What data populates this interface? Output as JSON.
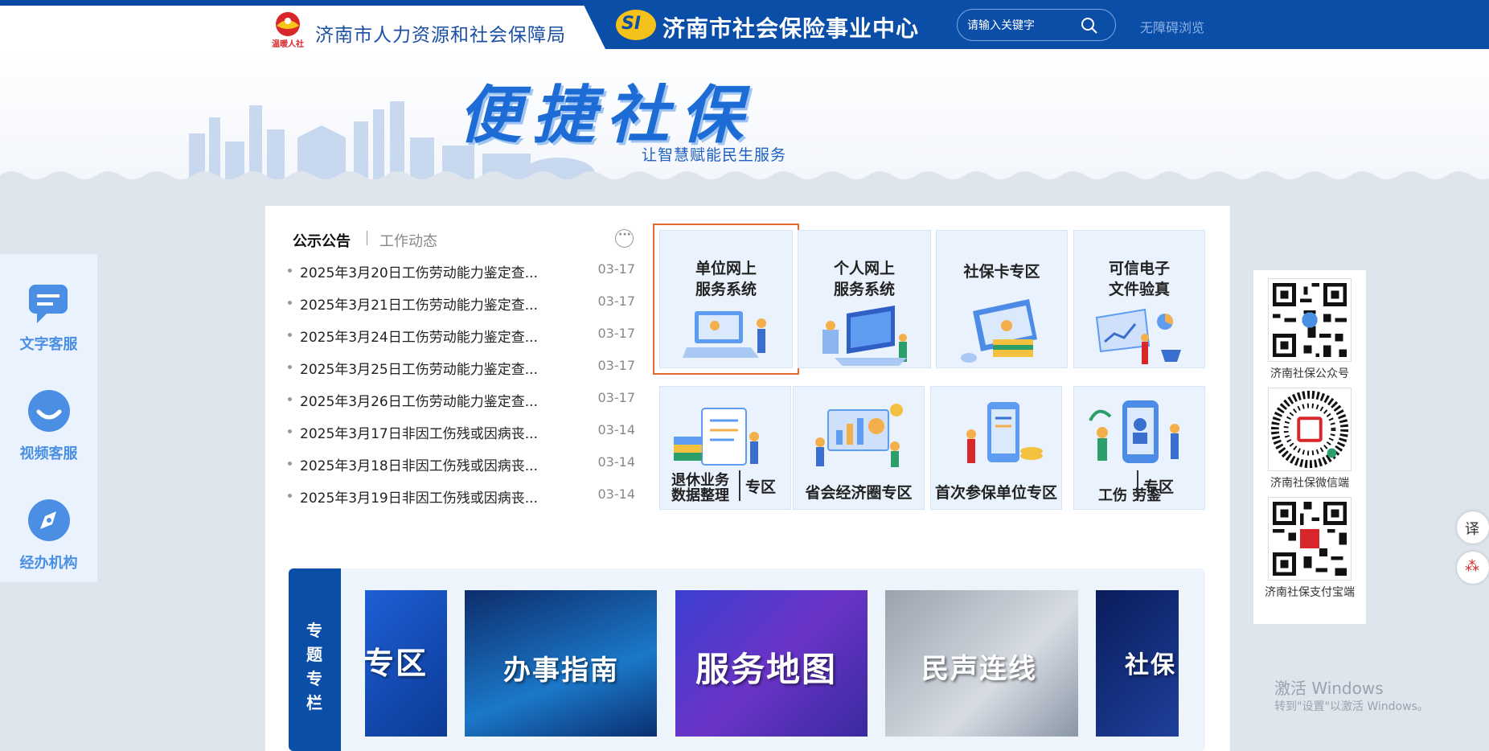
{
  "header": {
    "org_name": "济南市人力资源和社会保障局",
    "center_name": "济南市社会保险事业中心",
    "si_logo_text": "SI",
    "search_placeholder": "请输入关键字",
    "accessibility_link": "无障碍浏览",
    "logo_text": "温暖人社",
    "colors": {
      "brand_blue": "#0b4ea8",
      "logo_red": "#d8262a"
    }
  },
  "banner": {
    "title": "便捷社保",
    "subtitle": "让智慧赋能民生服务"
  },
  "news": {
    "tab_active": "公示公告",
    "tab_other": "工作动态",
    "items": [
      {
        "title": "2025年3月20日工伤劳动能力鉴定查...",
        "date": "03-17"
      },
      {
        "title": "2025年3月21日工伤劳动能力鉴定查...",
        "date": "03-17"
      },
      {
        "title": "2025年3月24日工伤劳动能力鉴定查...",
        "date": "03-17"
      },
      {
        "title": "2025年3月25日工伤劳动能力鉴定查...",
        "date": "03-17"
      },
      {
        "title": "2025年3月26日工伤劳动能力鉴定查...",
        "date": "03-17"
      },
      {
        "title": "2025年3月17日非因工伤残或因病丧...",
        "date": "03-14"
      },
      {
        "title": "2025年3月18日非因工伤残或因病丧...",
        "date": "03-14"
      },
      {
        "title": "2025年3月19日非因工伤残或因病丧...",
        "date": "03-14"
      }
    ]
  },
  "services_top": [
    {
      "label": "单位网上\n服务系统",
      "icon": "laptop-people-illustration",
      "selected": true
    },
    {
      "label": "个人网上\n服务系统",
      "icon": "server-people-illustration"
    },
    {
      "label": "社保卡专区",
      "icon": "card-reader-illustration"
    },
    {
      "label": "可信电子\n文件验真",
      "icon": "laptop-chart-illustration"
    }
  ],
  "services_bottom": [
    {
      "left": "退休业务\n数据整理",
      "right": "专区"
    },
    {
      "label": "省会经济圈专区"
    },
    {
      "label": "首次参保单位专区"
    },
    {
      "left": "工伤\n劳鉴",
      "right": "专区"
    }
  ],
  "topics": {
    "label": "专题专栏",
    "items": [
      "专区",
      "办事指南",
      "服务地图",
      "民声连线",
      "社保"
    ]
  },
  "left_float": [
    {
      "label": "文字客服",
      "icon": "chat-icon"
    },
    {
      "label": "视频客服",
      "icon": "video-chat-icon"
    },
    {
      "label": "经办机构",
      "icon": "compass-icon"
    }
  ],
  "right_float": [
    {
      "label": "济南社保公众号"
    },
    {
      "label": "济南社保微信端"
    },
    {
      "label": "济南社保支付宝端"
    }
  ],
  "side_tools": [
    "译",
    "⁂"
  ],
  "watermark": {
    "line1": "激活 Windows",
    "line2": "转到\"设置\"以激活 Windows。"
  }
}
